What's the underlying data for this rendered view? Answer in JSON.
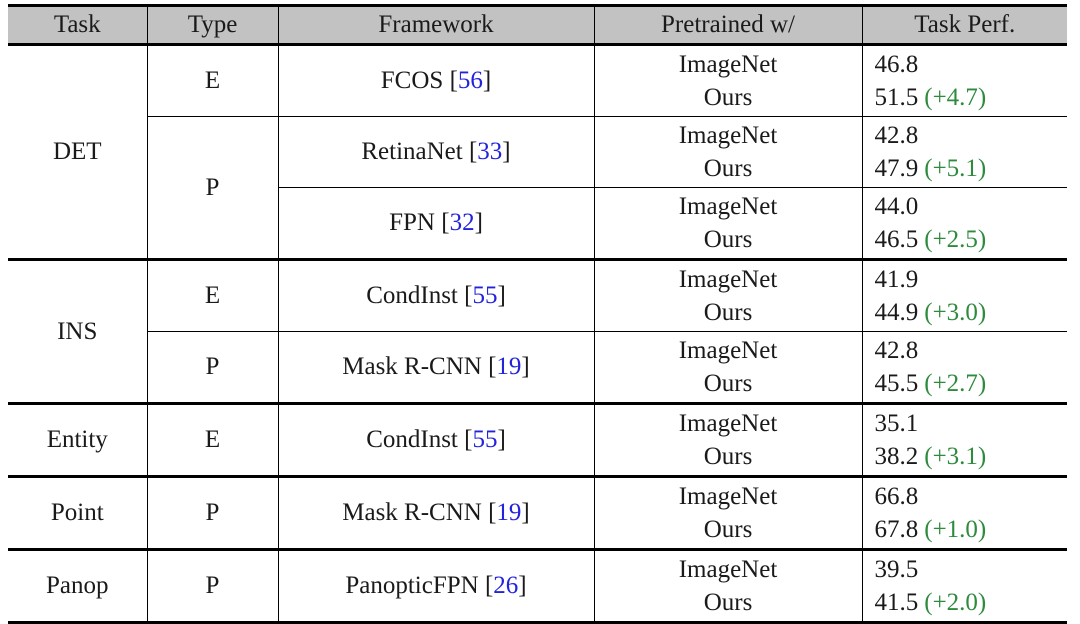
{
  "table": {
    "columns": [
      {
        "key": "task",
        "label": "Task"
      },
      {
        "key": "type",
        "label": "Type"
      },
      {
        "key": "framework",
        "label": "Framework"
      },
      {
        "key": "pretrain",
        "label": "Pretrained w/"
      },
      {
        "key": "perf",
        "label": "Task Perf."
      }
    ],
    "pretrain_labels": {
      "baseline": "ImageNet",
      "ours": "Ours"
    },
    "colors": {
      "header_background": "#c2c2c2",
      "gain_green": "#2e8b3e",
      "citation_blue": "#2323dd",
      "rule_black": "#000000",
      "text": "#1a1a1a"
    },
    "groups": [
      {
        "task": "DET",
        "types": [
          {
            "type": "E",
            "rows": [
              {
                "framework_name": "FCOS",
                "citation": "56",
                "baseline_value": "46.8",
                "ours_value": "51.5",
                "gain": "(+4.7)"
              }
            ]
          },
          {
            "type": "P",
            "rows": [
              {
                "framework_name": "RetinaNet",
                "citation": "33",
                "baseline_value": "42.8",
                "ours_value": "47.9",
                "gain": "(+5.1)"
              },
              {
                "framework_name": "FPN",
                "citation": "32",
                "baseline_value": "44.0",
                "ours_value": "46.5",
                "gain": "(+2.5)"
              }
            ]
          }
        ]
      },
      {
        "task": "INS",
        "types": [
          {
            "type": "E",
            "rows": [
              {
                "framework_name": "CondInst",
                "citation": "55",
                "baseline_value": "41.9",
                "ours_value": "44.9",
                "gain": "(+3.0)"
              }
            ]
          },
          {
            "type": "P",
            "rows": [
              {
                "framework_name": "Mask R-CNN",
                "citation": "19",
                "baseline_value": "42.8",
                "ours_value": "45.5",
                "gain": "(+2.7)"
              }
            ]
          }
        ]
      },
      {
        "task": "Entity",
        "types": [
          {
            "type": "E",
            "rows": [
              {
                "framework_name": "CondInst",
                "citation": "55",
                "baseline_value": "35.1",
                "ours_value": "38.2",
                "gain": "(+3.1)"
              }
            ]
          }
        ]
      },
      {
        "task": "Point",
        "types": [
          {
            "type": "P",
            "rows": [
              {
                "framework_name": "Mask R-CNN",
                "citation": "19",
                "baseline_value": "66.8",
                "ours_value": "67.8",
                "gain": "(+1.0)"
              }
            ]
          }
        ]
      },
      {
        "task": "Panop",
        "types": [
          {
            "type": "P",
            "rows": [
              {
                "framework_name": "PanopticFPN",
                "citation": "26",
                "baseline_value": "39.5",
                "ours_value": "41.5",
                "gain": "(+2.0)"
              }
            ]
          }
        ]
      }
    ]
  }
}
